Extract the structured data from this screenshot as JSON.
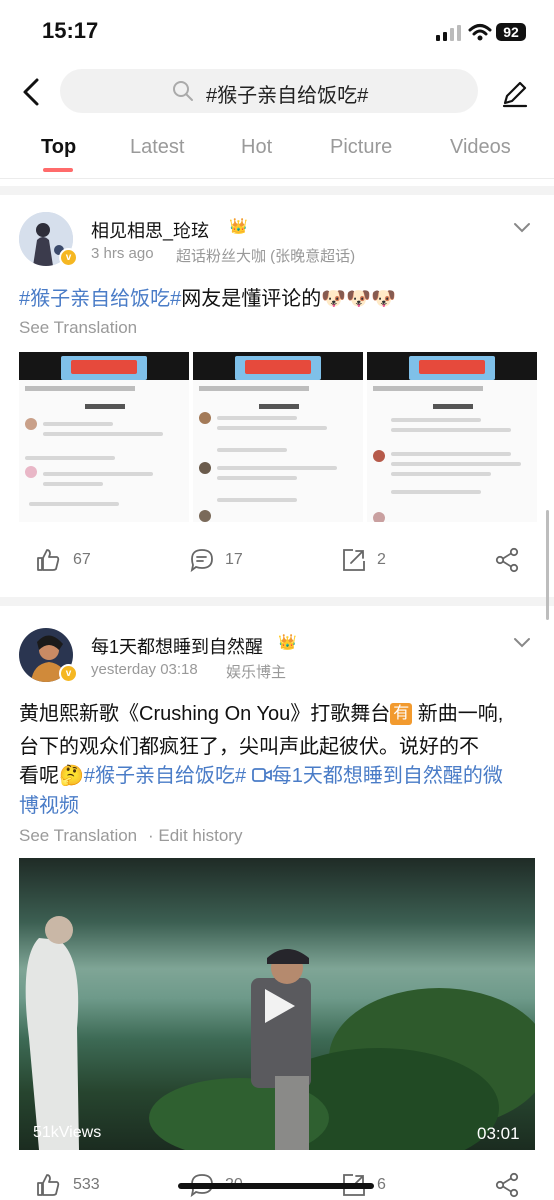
{
  "status": {
    "time": "15:17",
    "battery": "92"
  },
  "search": {
    "query": "#猴子亲自给饭吃#"
  },
  "tabs": [
    {
      "label": "Top",
      "active": true
    },
    {
      "label": "Latest"
    },
    {
      "label": "Hot"
    },
    {
      "label": "Picture"
    },
    {
      "label": "Videos"
    }
  ],
  "posts": [
    {
      "username": "相见相思_玱玹",
      "time": "3 hrs ago",
      "source": "超话粉丝大咖 (张晚意超话)",
      "text_tag": "#猴子亲自给饭吃#",
      "text_rest": "网友是懂评论的",
      "emoji": "🐶🐶🐶",
      "see_translation": "See Translation",
      "likes": "67",
      "comments": "17",
      "reposts": "2"
    },
    {
      "username": "每1天都想睡到自然醒",
      "time": "yesterday 03:18",
      "source": "娱乐博主",
      "text_p1": "黄旭熙新歌《Crushing On You》打歌舞台",
      "you_badge": "有",
      "text_p2": " 新曲一响,",
      "text_line2": "台下的观众们都疯狂了，尖叫声此起彼伏。说好的不",
      "text_line3a": "看呢",
      "emoji2": "🤔",
      "text_tag": "#猴子亲自给饭吃#",
      "video_link": "每1天都想睡到自然醒的微",
      "video_link2": "博视频",
      "see_translation": "See Translation",
      "edit_history": "· Edit history",
      "views": "51kViews",
      "duration": "03:01",
      "likes": "533",
      "comments": "20",
      "reposts": "6"
    }
  ],
  "accent": "#ff6b6b",
  "link_color": "#4a7cc7"
}
